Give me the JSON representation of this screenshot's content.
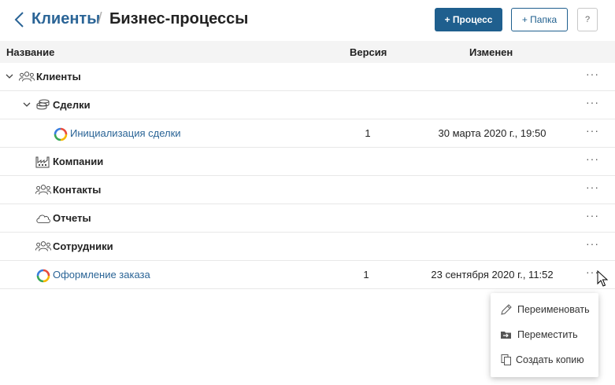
{
  "header": {
    "breadcrumb_parent": "Клиенты",
    "breadcrumb_separator": "/",
    "breadcrumb_current": "Бизнес-процессы",
    "add_process_label": "+ Процесс",
    "add_folder_label": "+ Папка",
    "help_label": "?"
  },
  "table": {
    "columns": {
      "name": "Название",
      "version": "Версия",
      "modified": "Изменен"
    },
    "rows": [
      {
        "name": "Клиенты",
        "type": "folder",
        "icon": "users-icon",
        "version": "",
        "modified": ""
      },
      {
        "name": "Сделки",
        "type": "folder",
        "icon": "coins-stack-icon",
        "version": "",
        "modified": ""
      },
      {
        "name": "Инициализация сделки",
        "type": "process",
        "icon": "process-ring-icon",
        "version": "1",
        "modified": "30 марта 2020 г., 19:50"
      },
      {
        "name": "Компании",
        "type": "folder",
        "icon": "factory-icon",
        "version": "",
        "modified": ""
      },
      {
        "name": "Контакты",
        "type": "folder",
        "icon": "users-icon",
        "version": "",
        "modified": ""
      },
      {
        "name": "Отчеты",
        "type": "folder",
        "icon": "cloud-icon",
        "version": "",
        "modified": ""
      },
      {
        "name": "Сотрудники",
        "type": "folder",
        "icon": "users-icon",
        "version": "",
        "modified": ""
      },
      {
        "name": "Оформление заказа",
        "type": "process",
        "icon": "process-ring-icon",
        "version": "1",
        "modified": "23 сентября 2020 г., 11:52"
      }
    ],
    "more_label": "···"
  },
  "context_menu": {
    "items": [
      {
        "label": "Переименовать",
        "icon": "pencil-icon"
      },
      {
        "label": "Переместить",
        "icon": "move-folder-icon"
      },
      {
        "label": "Создать копию",
        "icon": "copy-icon"
      }
    ]
  },
  "colors": {
    "accent": "#1f5f8e",
    "link": "#2a6496",
    "header_bg": "#f4f4f4"
  }
}
